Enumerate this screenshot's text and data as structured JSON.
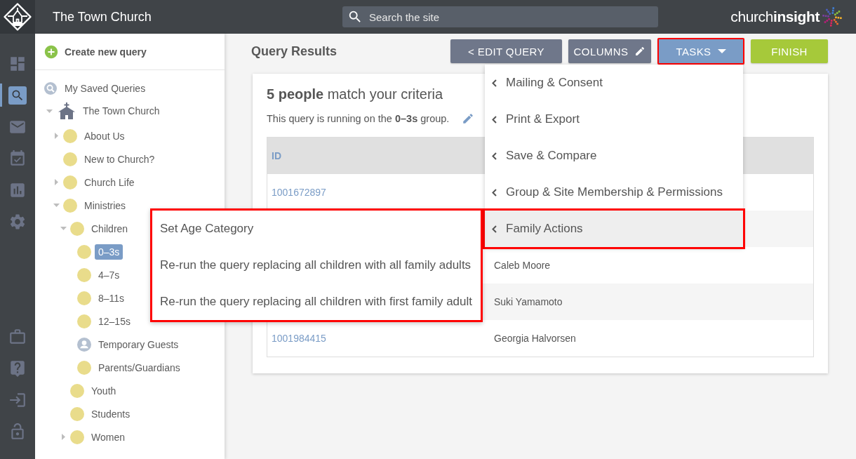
{
  "header": {
    "site_title": "The Town Church",
    "search": {
      "placeholder": "Search the site"
    },
    "brand": "church**insight**"
  },
  "nav_rail": {
    "top": [
      {
        "selected": false
      },
      {
        "selected": true
      },
      {
        "selected": false
      },
      {
        "selected": false
      },
      {
        "selected": false
      },
      {
        "selected": false
      }
    ],
    "bottom": [
      {
        "selected": false
      },
      {
        "selected": false
      },
      {
        "selected": false
      },
      {
        "selected": false
      }
    ]
  },
  "sidebar": {
    "create_button": "Create new query",
    "saved_queries": "My Saved Queries",
    "tree": {
      "label": "The Town Church",
      "expanded": true,
      "selected": false,
      "children": [
        {
          "label": "About Us",
          "kind": "group",
          "expanded": false,
          "selected": false
        },
        {
          "label": "New to Church?",
          "kind": "group",
          "selected": false
        },
        {
          "label": "Church Life",
          "kind": "group",
          "expanded": false,
          "selected": false
        },
        {
          "label": "Ministries",
          "kind": "group",
          "expanded": true,
          "selected": false,
          "children": [
            {
              "label": "Children",
              "kind": "group",
              "expanded": true,
              "selected": false,
              "children": [
                {
                  "label": "0–3s",
                  "kind": "group",
                  "selected": true
                },
                {
                  "label": "4–7s",
                  "kind": "group",
                  "selected": false
                },
                {
                  "label": "8–11s",
                  "kind": "group",
                  "selected": false
                },
                {
                  "label": "12–15s",
                  "kind": "group",
                  "selected": false
                },
                {
                  "label": "Temporary Guests",
                  "kind": "guests",
                  "selected": false
                },
                {
                  "label": "Parents/Guardians",
                  "kind": "group",
                  "selected": false
                }
              ]
            },
            {
              "label": "Youth",
              "kind": "group",
              "selected": false
            },
            {
              "label": "Students",
              "kind": "group",
              "selected": false
            },
            {
              "label": "Women",
              "kind": "group",
              "expanded": false,
              "selected": false
            }
          ]
        }
      ]
    }
  },
  "main": {
    "title": "Query Results",
    "toolbar": [
      {
        "label": "< EDIT QUERY",
        "kind": "edit",
        "highlighted": false
      },
      {
        "label": "COLUMNS",
        "kind": "columns",
        "highlighted": false
      },
      {
        "label": "TASKS",
        "kind": "tasks",
        "highlighted": true,
        "expanded": true,
        "menu": [
          {
            "label": "Mailing & Consent",
            "selected": false,
            "highlighted": false
          },
          {
            "label": "Print & Export",
            "selected": false,
            "highlighted": false
          },
          {
            "label": "Save & Compare",
            "selected": false,
            "highlighted": false
          },
          {
            "label": "Group & Site Membership & Permissions",
            "selected": false,
            "highlighted": false
          },
          {
            "label": "Family Actions",
            "selected": true,
            "highlighted": true,
            "submenu": {
              "highlighted": true,
              "items": [
                {
                  "label": "Set Age Category"
                },
                {
                  "label": "Re-run the query replacing all children with all family adults"
                },
                {
                  "label": "Re-run the query replacing all children with first family adult"
                }
              ]
            }
          }
        ]
      },
      {
        "label": "FINISH",
        "kind": "finish",
        "highlighted": false
      }
    ]
  },
  "results": {
    "heading": "**5 people** match your criteria",
    "note": "This query is running on the **0–3s** group.",
    "table": {
      "columns": [
        "ID"
      ],
      "rows": [
        {
          "id": "1001672897"
        },
        {},
        {
          "column_2": "Caleb Moore"
        },
        {
          "column_2": "Suki Yamamoto"
        },
        {
          "id": "1001984415",
          "column_2": "Georgia Halvorsen"
        }
      ]
    }
  }
}
